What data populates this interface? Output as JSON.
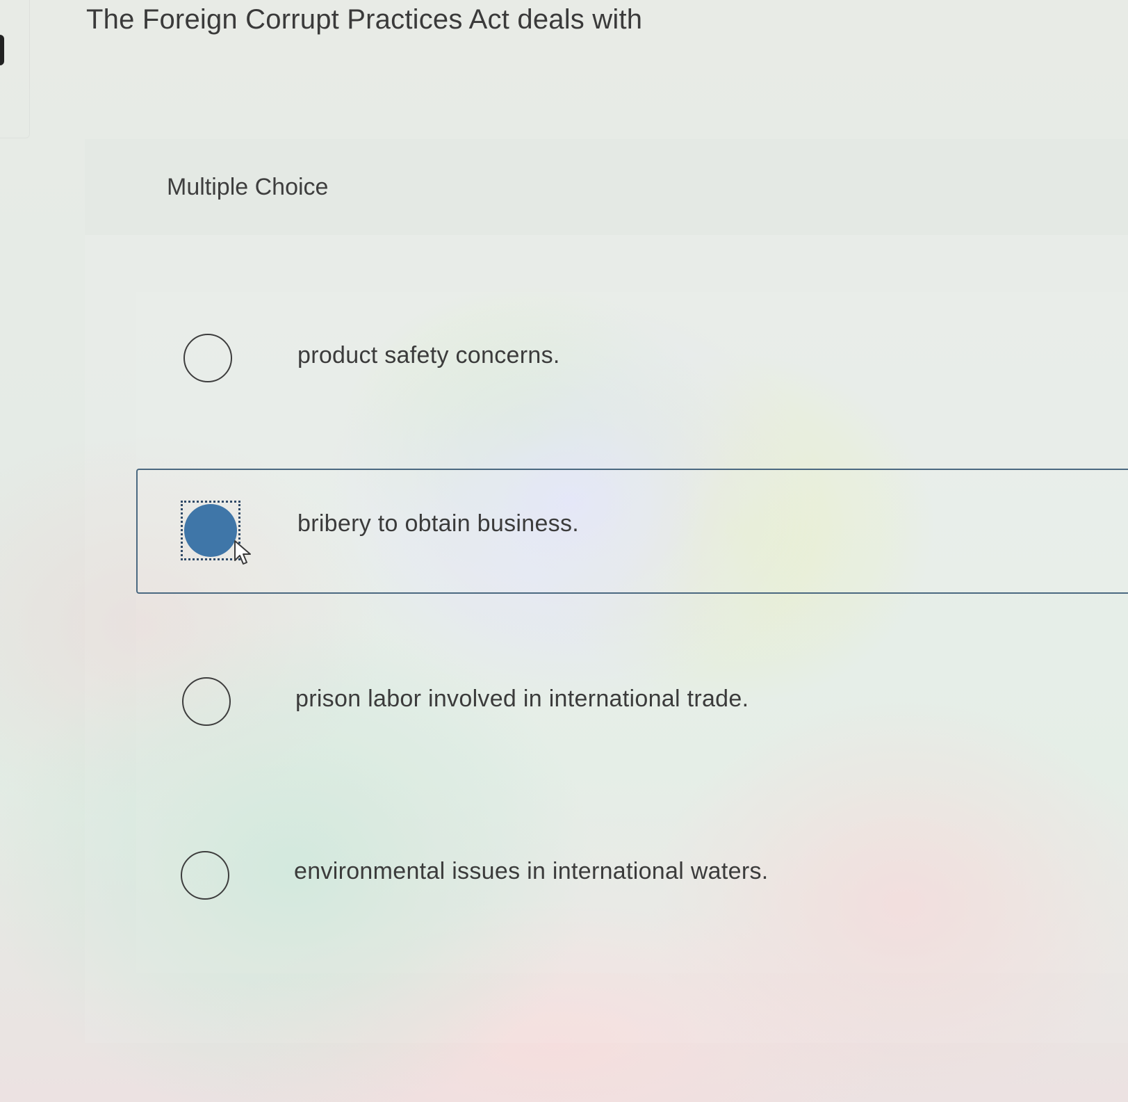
{
  "question": {
    "title": "The Foreign Corrupt Practices Act deals with"
  },
  "panel": {
    "type_label": "Multiple Choice"
  },
  "options": [
    {
      "label": "product safety concerns.",
      "selected": false
    },
    {
      "label": "bribery to obtain business.",
      "selected": true
    },
    {
      "label": "prison labor involved in international trade.",
      "selected": false
    },
    {
      "label": "environmental issues in international waters.",
      "selected": false
    }
  ],
  "colors": {
    "selected_radio": "#3f76a8",
    "selected_border": "#4a6880",
    "text": "#3b3b3b"
  },
  "icons": {
    "cursor": "mouse-pointer-arrow-icon"
  }
}
